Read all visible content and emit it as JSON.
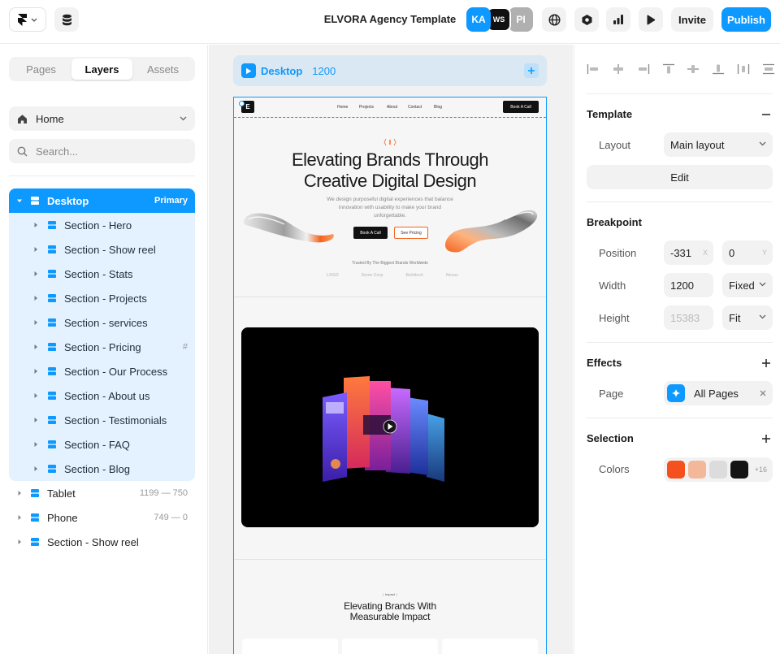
{
  "topbar": {
    "project_title": "ELVORA Agency Template",
    "avatars": [
      {
        "initials": "KA",
        "color": "#0d99ff"
      },
      {
        "initials": "WS",
        "color": "#111111"
      },
      {
        "initials": "PI",
        "color": "#b0b0b0"
      }
    ],
    "invite_label": "Invite",
    "publish_label": "Publish"
  },
  "left_panel": {
    "tabs": [
      "Pages",
      "Layers",
      "Assets"
    ],
    "active_tab": "Layers",
    "page_select": "Home",
    "search_placeholder": "Search...",
    "layers": [
      {
        "name": "Desktop",
        "meta": "Primary",
        "selected": true
      },
      {
        "name": "Section - Hero"
      },
      {
        "name": "Section - Show reel"
      },
      {
        "name": "Section - Stats"
      },
      {
        "name": "Section - Projects"
      },
      {
        "name": "Section - services"
      },
      {
        "name": "Section - Pricing",
        "meta": "#"
      },
      {
        "name": "Section - Our Process"
      },
      {
        "name": "Section - About us"
      },
      {
        "name": "Section - Testimonials"
      },
      {
        "name": "Section - FAQ"
      },
      {
        "name": "Section - Blog"
      }
    ],
    "other_layers": [
      {
        "name": "Tablet",
        "meta": "1199 — 750"
      },
      {
        "name": "Phone",
        "meta": "749 — 0"
      },
      {
        "name": "Section - Show reel",
        "meta": ""
      }
    ]
  },
  "canvas": {
    "breakpoint_name": "Desktop",
    "breakpoint_width": "1200",
    "site": {
      "logo": "E",
      "nav_links": [
        "Home",
        "Projects",
        "About",
        "Contact",
        "Blog"
      ],
      "nav_cta": "Book A Call",
      "hero_title_line1": "Elevating Brands Through",
      "hero_title_line2": "Creative Digital Design",
      "hero_sub": "We design purposeful digital experiences that balance innovation with usability to make your brand unforgettable.",
      "hero_btn_primary": "Book A Call",
      "hero_btn_secondary": "See Pricing",
      "trusted_text": "Trusted By The Biggest Brands Worldwide",
      "trusted_logos": [
        "LOGO",
        "Some Corp",
        "Boldtech",
        "Nexus"
      ],
      "impact_tag": "Impact",
      "impact_title_line1": "Elevating Brands With",
      "impact_title_line2": "Measurable Impact",
      "accent_color": "#f26522"
    }
  },
  "right_panel": {
    "template": {
      "title": "Template",
      "layout_label": "Layout",
      "layout_value": "Main layout",
      "edit_label": "Edit"
    },
    "breakpoint": {
      "title": "Breakpoint",
      "position_label": "Position",
      "position_x": "-331",
      "position_x_unit": "X",
      "position_y": "0",
      "position_y_unit": "Y",
      "width_label": "Width",
      "width_value": "1200",
      "width_mode": "Fixed",
      "height_label": "Height",
      "height_value": "15383",
      "height_mode": "Fit"
    },
    "effects": {
      "title": "Effects",
      "page_label": "Page",
      "page_value": "All Pages"
    },
    "selection": {
      "title": "Selection",
      "colors_label": "Colors",
      "colors": [
        "#f4511e",
        "#f3b89a",
        "#dcdcdc",
        "#141414"
      ],
      "more_count": "+16"
    }
  }
}
